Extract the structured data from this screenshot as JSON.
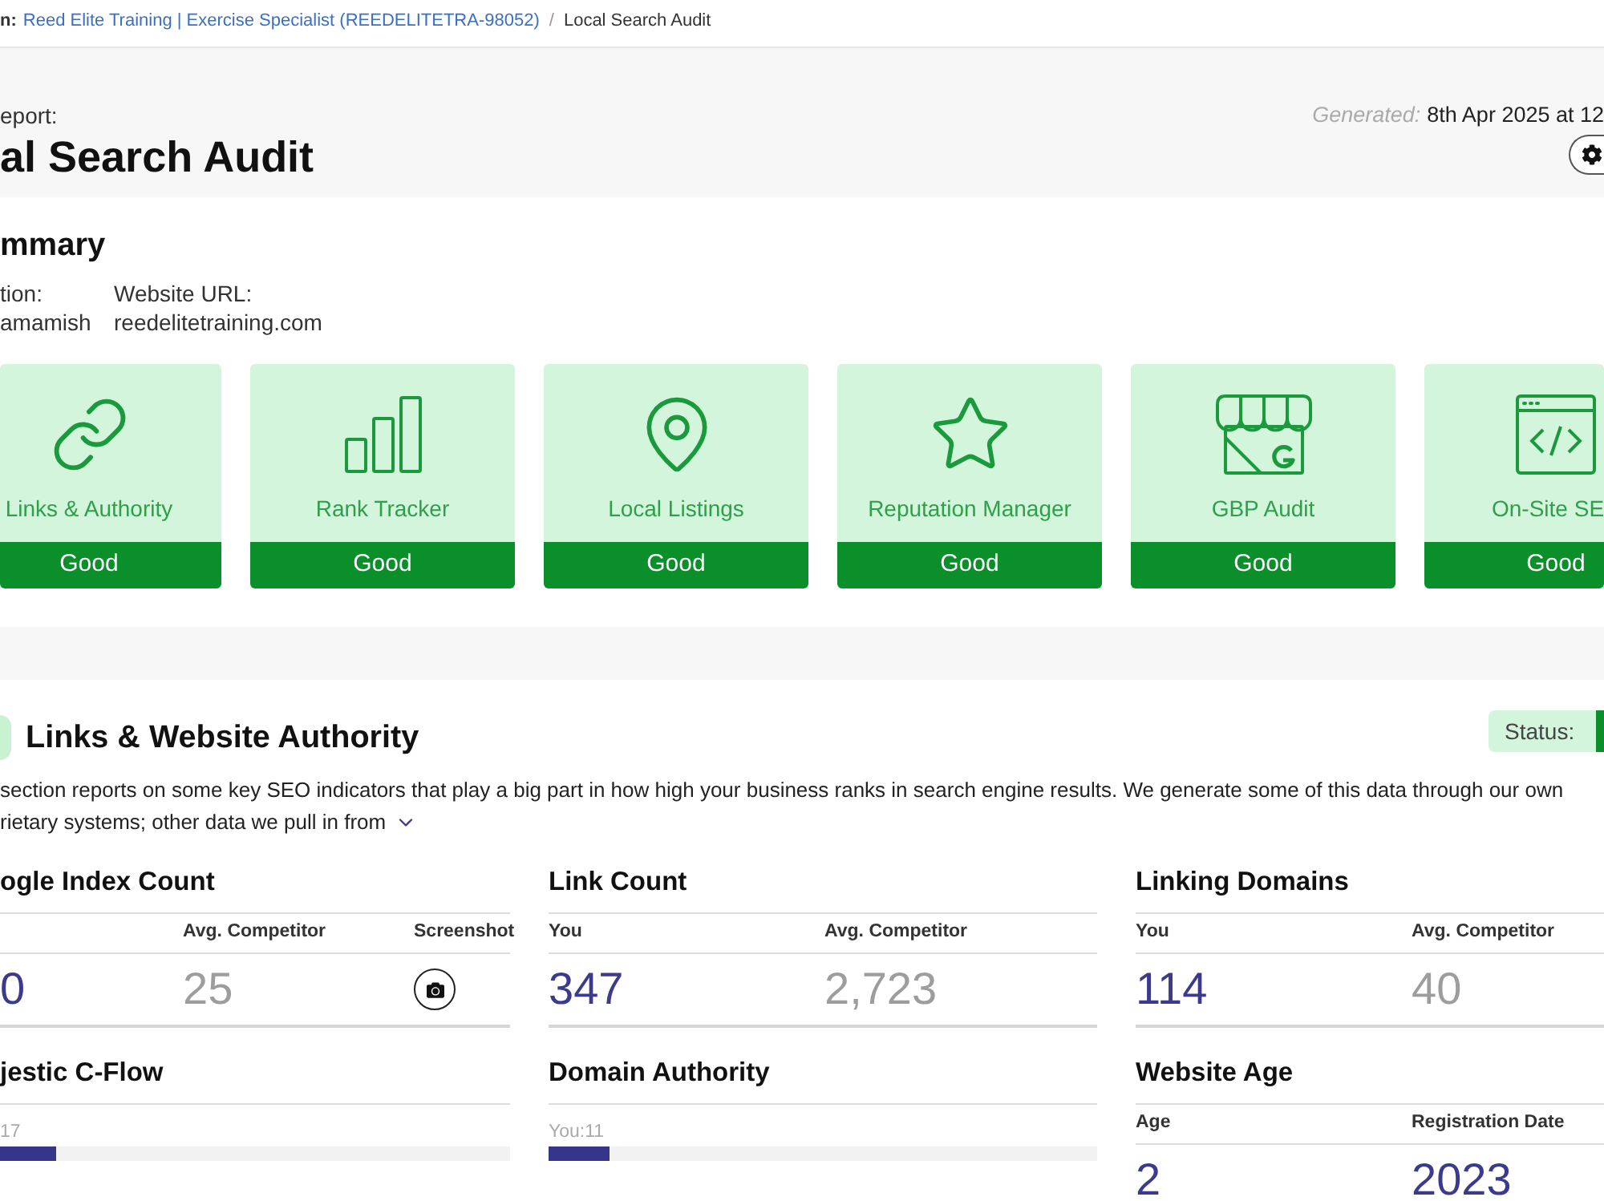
{
  "breadcrumb": {
    "prefix": "n:",
    "link": "Reed Elite Training | Exercise Specialist (REEDELITETRA-98052)",
    "separator": "/",
    "current": "Local Search Audit"
  },
  "header": {
    "label": "eport:",
    "title": "al Search Audit",
    "generated_label": "Generated:",
    "generated_value": "8th Apr 2025 at 12"
  },
  "summary": {
    "title": "mmary",
    "fields": [
      {
        "label": "tion:",
        "value": "amamish"
      },
      {
        "label": "Website URL:",
        "value": "reedelitetraining.com"
      }
    ],
    "cards": [
      {
        "label": "Links & Authority",
        "status": "Good"
      },
      {
        "label": "Rank Tracker",
        "status": "Good"
      },
      {
        "label": "Local Listings",
        "status": "Good"
      },
      {
        "label": "Reputation Manager",
        "status": "Good"
      },
      {
        "label": "GBP Audit",
        "status": "Good"
      },
      {
        "label": "On-Site SE",
        "status": "Good"
      }
    ]
  },
  "section": {
    "title": "Links & Website Authority",
    "status_label": "Status:",
    "description_lines": [
      "section reports on some key SEO indicators that play a big part in how high your business ranks in search engine results. We generate some of this data through our own",
      "rietary systems; other data we pull in from"
    ],
    "metrics": [
      {
        "title": "ogle Index Count",
        "kind": "table",
        "cells": [
          {
            "kind": "you",
            "value": "0"
          },
          {
            "kind": "competitor",
            "header": "Avg. Competitor",
            "value": "25"
          },
          {
            "kind": "screenshot",
            "header": "Screenshot"
          }
        ]
      },
      {
        "title": "Link Count",
        "kind": "table",
        "cells": [
          {
            "kind": "you",
            "header": "You",
            "value": "347"
          },
          {
            "kind": "competitor",
            "header": "Avg. Competitor",
            "value": "2,723"
          }
        ]
      },
      {
        "title": "Linking Domains",
        "kind": "table",
        "cells": [
          {
            "kind": "you",
            "header": "You",
            "value": "114"
          },
          {
            "kind": "competitor",
            "header": "Avg. Competitor",
            "value": "40"
          }
        ]
      },
      {
        "title": "jestic C-Flow",
        "kind": "bar",
        "reading": "17",
        "level": 0.11
      },
      {
        "title": "Domain Authority",
        "kind": "bar",
        "reading": "You:11",
        "level": 0.11
      },
      {
        "title": "Website Age",
        "kind": "table",
        "cells": [
          {
            "kind": "you",
            "header": "Age",
            "value": "2"
          },
          {
            "kind": "you",
            "header": "Registration Date",
            "value": "2023"
          }
        ]
      }
    ]
  }
}
